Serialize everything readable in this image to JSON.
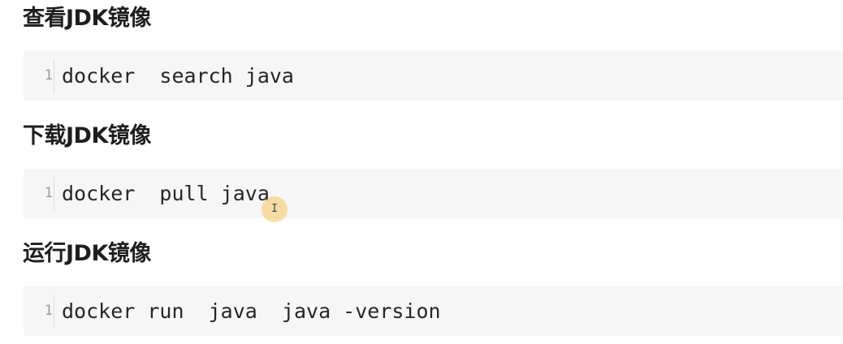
{
  "sections": [
    {
      "heading": "查看JDK镜像",
      "line_number": "1",
      "code": "docker  search java"
    },
    {
      "heading": "下载JDK镜像",
      "line_number": "1",
      "code": "docker  pull java"
    },
    {
      "heading": "运行JDK镜像",
      "line_number": "1",
      "code": "docker run  java  java -version"
    }
  ],
  "cursor": {
    "glyph": "I",
    "icon": "text-cursor-icon"
  },
  "colors": {
    "code_background": "#f6f6f6",
    "cursor_highlight": "#f5c660"
  }
}
